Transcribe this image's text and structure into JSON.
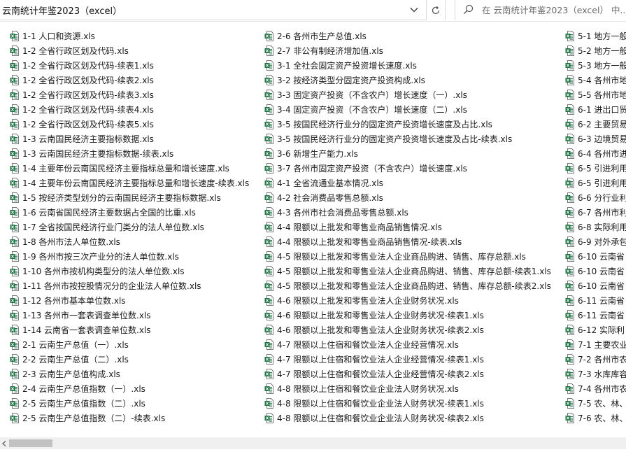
{
  "address_bar": {
    "path": "云南统计年鉴2023（excel）"
  },
  "search": {
    "placeholder": "在 云南统计年鉴2023（excel） 中..."
  },
  "files": {
    "column1": [
      "1-1  人口和资源.xls",
      "1-2  全省行政区划及代码.xls",
      "1-2  全省行政区划及代码-续表1.xls",
      "1-2  全省行政区划及代码-续表2.xls",
      "1-2  全省行政区划及代码-续表3.xls",
      "1-2  全省行政区划及代码-续表4.xls",
      "1-2  全省行政区划及代码-续表5.xls",
      "1-3  云南国民经济主要指标数据.xls",
      "1-3  云南国民经济主要指标数据-续表.xls",
      "1-4  主要年份云南国民经济主要指标总量和增长速度.xls",
      "1-4  主要年份云南国民经济主要指标总量和增长速度-续表.xls",
      "1-5  按经济类型划分的云南国民经济主要指标数据.xls",
      "1-6  云南省国民经济主要数据占全国的比重.xls",
      "1-7  全省按国民经济行业门类分的法人单位数.xls",
      "1-8  各州市法人单位数.xls",
      "1-9  各州市按三次产业分的法人单位数.xls",
      "1-10  各州市按机构类型分的法人单位数.xls",
      "1-11  各州市按控股情况分的企业法人单位数.xls",
      "1-12  各州市基本单位数.xls",
      "1-13  各州市一套表调查单位数.xls",
      "1-14  云南省一套表调查单位数.xls",
      "2-1  云南生产总值（一）.xls",
      "2-2  云南生产总值（二）.xls",
      "2-3  云南生产总值构成.xls",
      "2-4  云南生产总值指数（一）.xls",
      "2-5  云南生产总值指数（二）.xls",
      "2-5  云南生产总值指数（二）-续表.xls"
    ],
    "column2": [
      "2-6  各州市生产总值.xls",
      "2-7  非公有制经济增加值.xls",
      "3-1  全社会固定资产投资增长速度.xls",
      "3-2  按经济类型分固定资产投资构成.xls",
      "3-3  固定资产投资（不含农户）增长速度（一）.xls",
      "3-4  固定资产投资（不含农户）增长速度（二）.xls",
      "3-5  按国民经济行业分的固定资产投资增长速度及占比.xls",
      "3-5  按国民经济行业分的固定资产投资增长速度及占比-续表.xls",
      "3-6  新增生产能力.xls",
      "3-7  各州市固定资产投资（不含农户）增长速度.xls",
      "4-1  全省流通业基本情况.xls",
      "4-2  社会消费品零售总额.xls",
      "4-3  各州市社会消费品零售总额.xls",
      "4-4  限额以上批发和零售业商品销售情况.xls",
      "4-4  限额以上批发和零售业商品销售情况-续表.xls",
      "4-5  限额以上批发和零售业法人企业商品购进、销售、库存总额.xls",
      "4-5  限额以上批发和零售业法人企业商品购进、销售、库存总额-续表1.xls",
      "4-5  限额以上批发和零售业法人企业商品购进、销售、库存总额-续表2.xls",
      "4-6  限额以上批发和零售业法人企业财务状况.xls",
      "4-6  限额以上批发和零售业法人企业财务状况-续表1.xls",
      "4-6  限额以上批发和零售业法人企业财务状况-续表2.xls",
      "4-7  限额以上住宿和餐饮业法人企业经营情况.xls",
      "4-7  限额以上住宿和餐饮业法人企业经营情况-续表1.xls",
      "4-7  限额以上住宿和餐饮业法人企业经营情况-续表2.xls",
      "4-8  限额以上住宿和餐饮业企业法人财务状况.xls",
      "4-8  限额以上住宿和餐饮业企业法人财务状况-续表1.xls",
      "4-8  限额以上住宿和餐饮业企业法人财务状况-续表2.xls"
    ],
    "column3": [
      "5-1  地方一般",
      "5-2  地方一般",
      "5-3  地方一般",
      "5-4  各州市地",
      "5-5  各州市地",
      "6-1  进出口贸",
      "6-2  主要贸易",
      "6-3  边境贸易",
      "6-4  各州市进",
      "6-5  引进利用",
      "6-5  引进利用",
      "6-6  分行业利",
      "6-7  各州市利",
      "6-8  实际利用",
      "6-9  对外承包",
      "6-10  云南省",
      "6-10  云南省",
      "6-10  云南省",
      "6-11  云南省",
      "6-11  云南省",
      "6-12  实际利",
      "7-1  主要农业",
      "7-2  各州市农",
      "7-3  水库库容",
      "7-4  各州市农",
      "7-5  农、林、",
      "7-6  农、林、"
    ]
  },
  "icons": {
    "file": "excel-file-icon",
    "chevron": "chevron-down-icon",
    "refresh": "refresh-icon",
    "search": "search-icon",
    "scroll_left": "scroll-left-arrow-icon"
  },
  "colors": {
    "excel_green": "#217346"
  }
}
